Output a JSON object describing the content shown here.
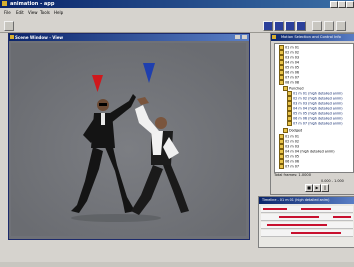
{
  "app": {
    "title": "animation - app",
    "menu": [
      "File",
      "Edit",
      "View",
      "Tools",
      "Help"
    ]
  },
  "viewport": {
    "title": "Scene Window - View"
  },
  "panel": {
    "title": "Motion Selection and Control Info",
    "tree": [
      {
        "label": "01 m 01",
        "selected": false
      },
      {
        "label": "02 m 02",
        "selected": false
      },
      {
        "label": "03 m 03",
        "selected": false
      },
      {
        "label": "04 m 04",
        "selected": false
      },
      {
        "label": "05 m 05",
        "selected": false
      },
      {
        "label": "06 m 06",
        "selected": false
      },
      {
        "label": "07 m 07",
        "selected": false
      },
      {
        "label": "08 m 08",
        "selected": false
      },
      {
        "label": "Punched",
        "selected": false
      },
      {
        "label": "01 m 01 (high detailed anim)",
        "selected": true
      },
      {
        "label": "02 m 02 (high detailed anim)",
        "selected": true
      },
      {
        "label": "03 m 03 (high detailed anim)",
        "selected": true
      },
      {
        "label": "04 m 04 (high detailed anim)",
        "selected": true
      },
      {
        "label": "05 m 05 (high detailed anim)",
        "selected": true
      },
      {
        "label": "06 m 06 (high detailed anim)",
        "selected": true
      },
      {
        "label": "07 m 07 (high detailed anim)",
        "selected": true
      },
      {
        "label": "Dodged",
        "selected": false
      },
      {
        "label": "01 m 01",
        "selected": false
      },
      {
        "label": "02 m 02",
        "selected": false
      },
      {
        "label": "03 m 03",
        "selected": false
      },
      {
        "label": "04 m 04 (high detailed anim)",
        "selected": false
      },
      {
        "label": "05 m 05",
        "selected": false
      },
      {
        "label": "06 m 06",
        "selected": false
      },
      {
        "label": "07 m 07",
        "selected": false
      }
    ],
    "footer": "Total frames: 1.0000",
    "range": "0.000 - 1.000"
  },
  "timeline": {
    "title": "Timeline - 01 m 01 (high detailed anim)"
  },
  "colors": {
    "cone_left": "#d0181c",
    "cone_right": "#1f3fae",
    "accent": "#0a246a"
  }
}
